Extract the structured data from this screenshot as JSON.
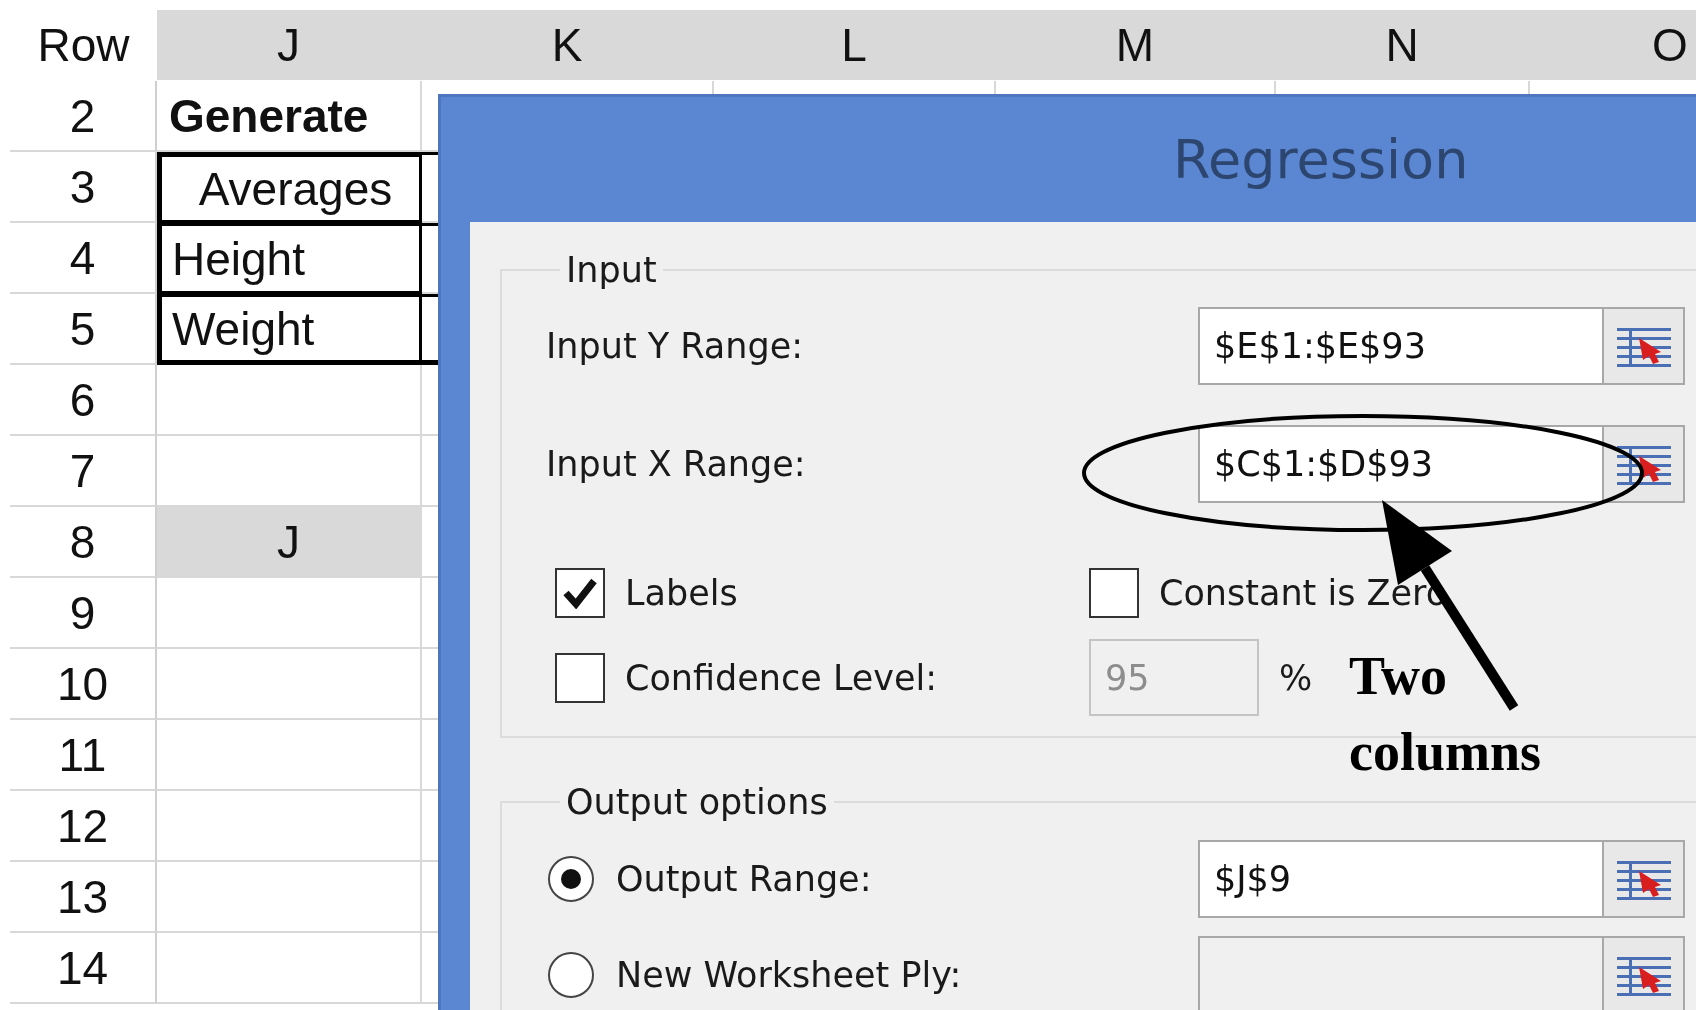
{
  "sheet": {
    "corner_label": "Row",
    "columns": [
      "J",
      "K",
      "L",
      "M",
      "N",
      "O"
    ],
    "rows": [
      {
        "number": "2",
        "kind": "title",
        "cell": "Generate"
      },
      {
        "number": "3",
        "kind": "boxed-center",
        "cell": "Averages"
      },
      {
        "number": "4",
        "kind": "boxed",
        "cell": "Height"
      },
      {
        "number": "5",
        "kind": "boxed",
        "cell": "Weight"
      },
      {
        "number": "6",
        "kind": "blank"
      },
      {
        "number": "7",
        "kind": "blank"
      },
      {
        "number": "8",
        "kind": "header",
        "cell": "J"
      },
      {
        "number": "9",
        "kind": "blank"
      },
      {
        "number": "10",
        "kind": "blank"
      },
      {
        "number": "11",
        "kind": "blank"
      },
      {
        "number": "12",
        "kind": "blank"
      },
      {
        "number": "13",
        "kind": "blank"
      },
      {
        "number": "14",
        "kind": "blank"
      }
    ]
  },
  "dialog": {
    "title": "Regression",
    "input": {
      "heading": "Input",
      "fields": [
        {
          "label": "Input Y Range:",
          "value": "$E$1:$E$93"
        },
        {
          "label": "Input X Range:",
          "value": "$C$1:$D$93"
        }
      ],
      "options": [
        {
          "label": "Labels",
          "checked": true
        },
        {
          "label": "Constant is Zero",
          "checked": false
        },
        {
          "label": "Confidence Level:",
          "checked": false
        }
      ],
      "confidence": {
        "value": "95",
        "disabled": true,
        "unit": "%"
      }
    },
    "output": {
      "heading": "Output options",
      "choices": [
        {
          "label": "Output Range:",
          "selected": true,
          "value": "$J$9"
        },
        {
          "label": "New Worksheet Ply:",
          "selected": false
        }
      ]
    }
  },
  "annotation": {
    "text": "Two columns"
  }
}
